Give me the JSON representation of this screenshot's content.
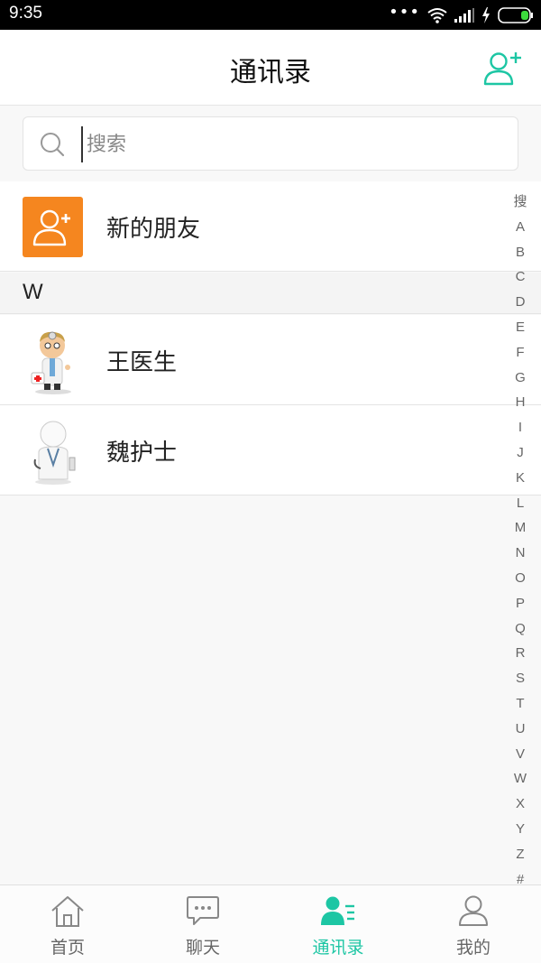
{
  "status_bar": {
    "time": "9:35",
    "dots": "•••"
  },
  "header": {
    "title": "通讯录"
  },
  "search": {
    "placeholder": "搜索"
  },
  "new_friends": {
    "label": "新的朋友"
  },
  "contacts": {
    "section_letter": "W",
    "items": [
      {
        "name": "王医生"
      },
      {
        "name": "魏护士"
      }
    ]
  },
  "index_bar": [
    "搜",
    "A",
    "B",
    "C",
    "D",
    "E",
    "F",
    "G",
    "H",
    "I",
    "J",
    "K",
    "L",
    "M",
    "N",
    "O",
    "P",
    "Q",
    "R",
    "S",
    "T",
    "U",
    "V",
    "W",
    "X",
    "Y",
    "Z",
    "#"
  ],
  "tabs": [
    {
      "label": "首页",
      "icon": "home-icon",
      "active": false
    },
    {
      "label": "聊天",
      "icon": "chat-icon",
      "active": false
    },
    {
      "label": "通讯录",
      "icon": "contacts-icon",
      "active": true
    },
    {
      "label": "我的",
      "icon": "profile-icon",
      "active": false
    }
  ],
  "colors": {
    "accent": "#1dc6a4",
    "new_friend_bg": "#f5861f",
    "status_bar": "#000000"
  }
}
